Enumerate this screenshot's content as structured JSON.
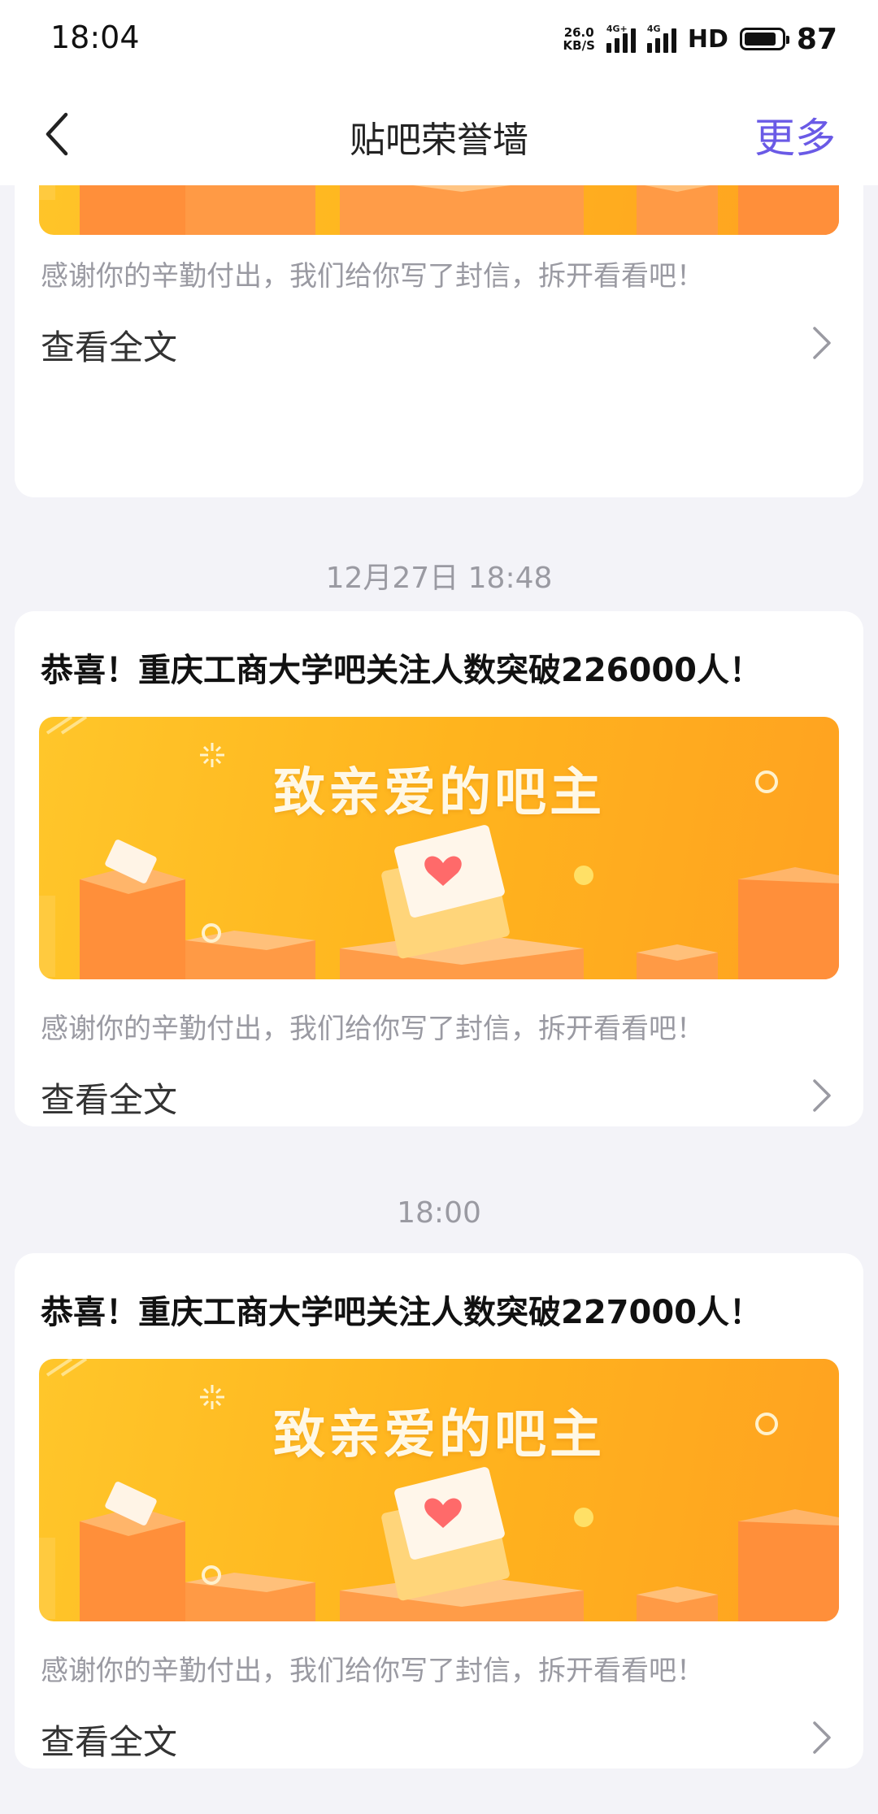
{
  "status_bar": {
    "time": "18:04",
    "net_speed_value": "26.0",
    "net_speed_unit": "KB/S",
    "signal1_tag": "4G+",
    "signal2_tag": "4G",
    "hd": "HD",
    "battery": "87"
  },
  "nav": {
    "title": "贴吧荣誉墙",
    "more": "更多"
  },
  "banner": {
    "heading": "致亲爱的吧主"
  },
  "messages": [
    {
      "description": "感谢你的辛勤付出，我们给你写了封信，拆开看看吧！",
      "read_more": "查看全文"
    },
    {
      "timestamp": "12月27日 18:48",
      "title": "恭喜！重庆工商大学吧关注人数突破226000人！",
      "description": "感谢你的辛勤付出，我们给你写了封信，拆开看看吧！",
      "read_more": "查看全文"
    },
    {
      "timestamp": "18:00",
      "title": "恭喜！重庆工商大学吧关注人数突破227000人！",
      "description": "感谢你的辛勤付出，我们给你写了封信，拆开看看吧！",
      "read_more": "查看全文"
    }
  ],
  "colors": {
    "accent": "#6a5ae6",
    "banner_start": "#ffc62a",
    "banner_end": "#ffa220",
    "page_bg": "#f3f3f8"
  }
}
